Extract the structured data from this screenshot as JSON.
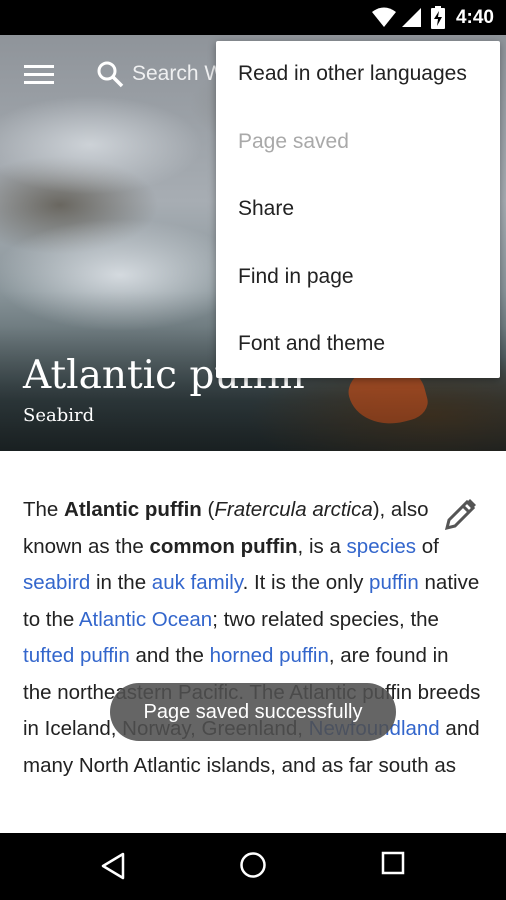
{
  "status_bar": {
    "time": "4:40",
    "icons": [
      "wifi-icon",
      "signal-icon",
      "battery-charging-icon"
    ]
  },
  "toolbar": {
    "menu_icon": "hamburger-menu-icon",
    "search_icon": "search-icon",
    "search_placeholder": "Search W"
  },
  "header": {
    "title": "Atlantic puffin",
    "subtitle": "Seabird"
  },
  "overflow_menu": {
    "items": [
      {
        "label": "Read in other languages",
        "enabled": true
      },
      {
        "label": "Page saved",
        "enabled": false
      },
      {
        "label": "Share",
        "enabled": true
      },
      {
        "label": "Find in page",
        "enabled": true
      },
      {
        "label": "Font and theme",
        "enabled": true
      }
    ]
  },
  "article": {
    "t1": "The ",
    "bold1": "Atlantic puffin",
    "t2": " (",
    "italic1": "Fratercula arctica",
    "t3": "), also known as the ",
    "bold2": "common puffin",
    "t4": ", is a ",
    "link_species": "species",
    "t5": " of ",
    "link_seabird": "seabird",
    "t6": " in the ",
    "link_auk": "auk family",
    "t7": ". It is the only ",
    "link_puffin": "puffin",
    "t8": " native to the ",
    "link_atlantic": "Atlantic Ocean",
    "t9": "; two related species, the ",
    "link_tufted": "tufted puffin",
    "t10": " and the ",
    "link_horned": "horned puffin",
    "t11": ", are found in the northeastern Pacific. The Atlantic puffin breeds in Iceland, Norway, Greenland, ",
    "link_newfoundland": "Newfoundland",
    "t12": " and many North Atlantic islands, and as far south as"
  },
  "toast": {
    "message": "Page saved successfully"
  },
  "nav_bar": {
    "buttons": [
      "back-icon",
      "home-icon",
      "recents-icon"
    ]
  },
  "colors": {
    "link": "#3366cc",
    "toast_bg": "#505050",
    "disabled_text": "#a9a9a9"
  }
}
